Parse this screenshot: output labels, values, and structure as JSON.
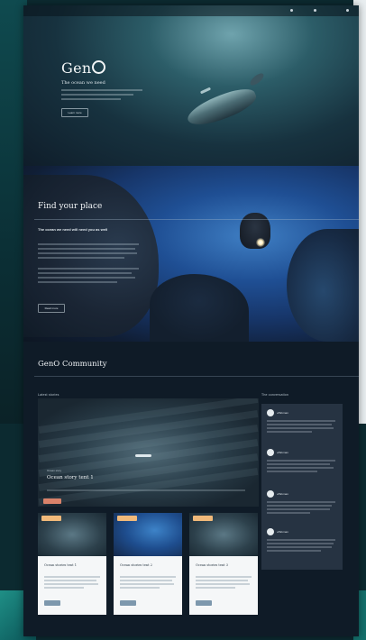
{
  "hero": {
    "logo_text": "Gen",
    "tagline": "The ocean we need",
    "cta_label": "Learn more"
  },
  "find_section": {
    "title": "Find your place",
    "subtitle": "The ocean we need will need you as well",
    "cta_label": "Read more"
  },
  "community": {
    "title": "GenO Community",
    "latest_label": "Latest stories",
    "conversation_label": "The conversation",
    "featured": {
      "meta": "Ocean story",
      "title": "Ocean story tent 1"
    },
    "cards": [
      {
        "title": "Ocean stories tent 1"
      },
      {
        "title": "Ocean stories tent 2"
      },
      {
        "title": "Ocean stories tent 3"
      }
    ],
    "comments": [
      {
        "name": "u/Woman"
      },
      {
        "name": "u/Woman"
      },
      {
        "name": "u/Woman"
      },
      {
        "name": "u/Woman"
      }
    ]
  },
  "colors": {
    "page_bg": "#0f1b27",
    "accent_tag": "#d9826a",
    "card_tag": "#f0b97a",
    "card_button": "#7d98ad"
  }
}
